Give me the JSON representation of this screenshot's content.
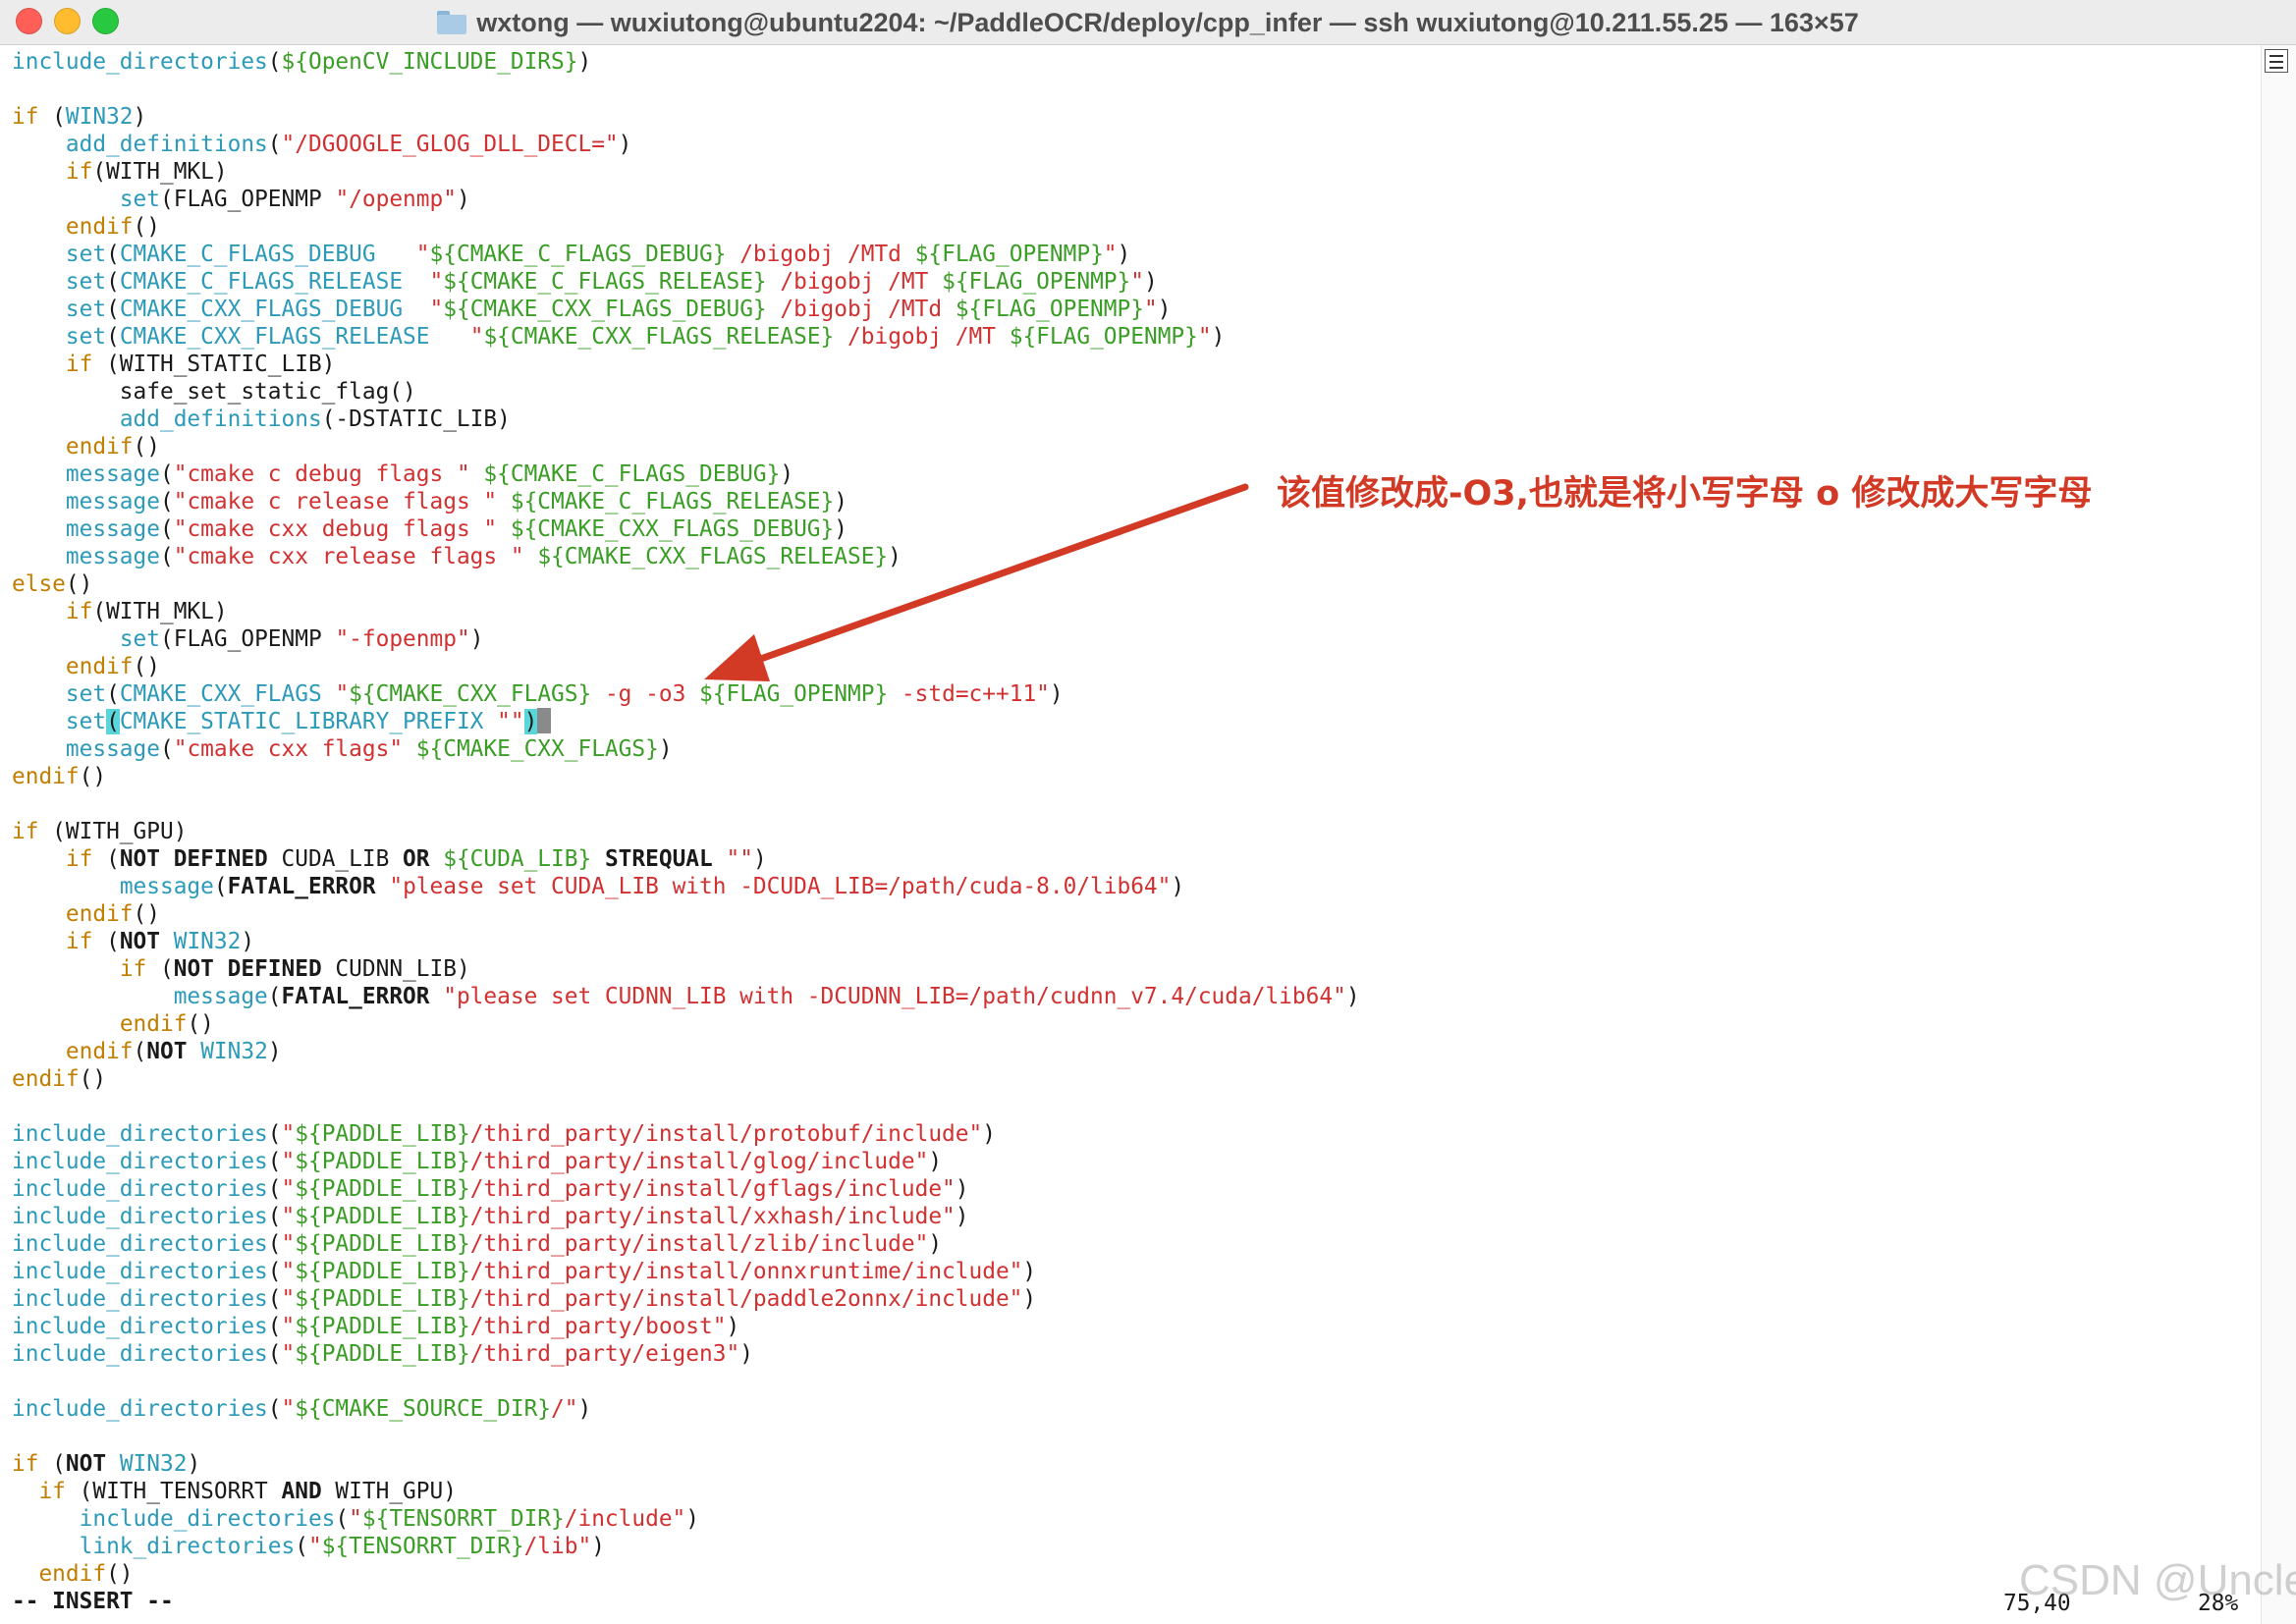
{
  "window": {
    "title": "wxtong — wuxiutong@ubuntu2204: ~/PaddleOCR/deploy/cpp_infer — ssh wuxiutong@10.211.55.25 — 163×57"
  },
  "editor": {
    "lines": [
      [
        [
          "f",
          "include_directories"
        ],
        [
          "p",
          "("
        ],
        [
          "v",
          "${OpenCV_INCLUDE_DIRS}"
        ],
        [
          "p",
          ")"
        ]
      ],
      [],
      [
        [
          "k",
          "if"
        ],
        [
          "p",
          " ("
        ],
        [
          "vr",
          "WIN32"
        ],
        [
          "p",
          ")"
        ]
      ],
      [
        [
          "p",
          "    "
        ],
        [
          "f",
          "add_definitions"
        ],
        [
          "p",
          "("
        ],
        [
          "s",
          "\"/DGOOGLE_GLOG_DLL_DECL=\""
        ],
        [
          "p",
          ")"
        ]
      ],
      [
        [
          "p",
          "    "
        ],
        [
          "k",
          "if"
        ],
        [
          "p",
          "(WITH_MKL)"
        ]
      ],
      [
        [
          "p",
          "        "
        ],
        [
          "f",
          "set"
        ],
        [
          "p",
          "(FLAG_OPENMP "
        ],
        [
          "s",
          "\"/openmp\""
        ],
        [
          "p",
          ")"
        ]
      ],
      [
        [
          "p",
          "    "
        ],
        [
          "k",
          "endif"
        ],
        [
          "p",
          "()"
        ]
      ],
      [
        [
          "p",
          "    "
        ],
        [
          "f",
          "set"
        ],
        [
          "p",
          "("
        ],
        [
          "vr",
          "CMAKE_C_FLAGS_DEBUG"
        ],
        [
          "p",
          "   "
        ],
        [
          "s",
          "\""
        ],
        [
          "v",
          "${CMAKE_C_FLAGS_DEBUG}"
        ],
        [
          "s",
          " /bigobj /MTd "
        ],
        [
          "v",
          "${FLAG_OPENMP}"
        ],
        [
          "s",
          "\""
        ],
        [
          "p",
          ")"
        ]
      ],
      [
        [
          "p",
          "    "
        ],
        [
          "f",
          "set"
        ],
        [
          "p",
          "("
        ],
        [
          "vr",
          "CMAKE_C_FLAGS_RELEASE"
        ],
        [
          "p",
          "  "
        ],
        [
          "s",
          "\""
        ],
        [
          "v",
          "${CMAKE_C_FLAGS_RELEASE}"
        ],
        [
          "s",
          " /bigobj /MT "
        ],
        [
          "v",
          "${FLAG_OPENMP}"
        ],
        [
          "s",
          "\""
        ],
        [
          "p",
          ")"
        ]
      ],
      [
        [
          "p",
          "    "
        ],
        [
          "f",
          "set"
        ],
        [
          "p",
          "("
        ],
        [
          "vr",
          "CMAKE_CXX_FLAGS_DEBUG"
        ],
        [
          "p",
          "  "
        ],
        [
          "s",
          "\""
        ],
        [
          "v",
          "${CMAKE_CXX_FLAGS_DEBUG}"
        ],
        [
          "s",
          " /bigobj /MTd "
        ],
        [
          "v",
          "${FLAG_OPENMP}"
        ],
        [
          "s",
          "\""
        ],
        [
          "p",
          ")"
        ]
      ],
      [
        [
          "p",
          "    "
        ],
        [
          "f",
          "set"
        ],
        [
          "p",
          "("
        ],
        [
          "vr",
          "CMAKE_CXX_FLAGS_RELEASE"
        ],
        [
          "p",
          "   "
        ],
        [
          "s",
          "\""
        ],
        [
          "v",
          "${CMAKE_CXX_FLAGS_RELEASE}"
        ],
        [
          "s",
          " /bigobj /MT "
        ],
        [
          "v",
          "${FLAG_OPENMP}"
        ],
        [
          "s",
          "\""
        ],
        [
          "p",
          ")"
        ]
      ],
      [
        [
          "p",
          "    "
        ],
        [
          "k",
          "if"
        ],
        [
          "p",
          " (WITH_STATIC_LIB)"
        ]
      ],
      [
        [
          "p",
          "        safe_set_static_flag()"
        ]
      ],
      [
        [
          "p",
          "        "
        ],
        [
          "f",
          "add_definitions"
        ],
        [
          "p",
          "(-DSTATIC_LIB)"
        ]
      ],
      [
        [
          "p",
          "    "
        ],
        [
          "k",
          "endif"
        ],
        [
          "p",
          "()"
        ]
      ],
      [
        [
          "p",
          "    "
        ],
        [
          "f",
          "message"
        ],
        [
          "p",
          "("
        ],
        [
          "s",
          "\"cmake c debug flags \""
        ],
        [
          "p",
          " "
        ],
        [
          "v",
          "${CMAKE_C_FLAGS_DEBUG}"
        ],
        [
          "p",
          ")"
        ]
      ],
      [
        [
          "p",
          "    "
        ],
        [
          "f",
          "message"
        ],
        [
          "p",
          "("
        ],
        [
          "s",
          "\"cmake c release flags \""
        ],
        [
          "p",
          " "
        ],
        [
          "v",
          "${CMAKE_C_FLAGS_RELEASE}"
        ],
        [
          "p",
          ")"
        ]
      ],
      [
        [
          "p",
          "    "
        ],
        [
          "f",
          "message"
        ],
        [
          "p",
          "("
        ],
        [
          "s",
          "\"cmake cxx debug flags \""
        ],
        [
          "p",
          " "
        ],
        [
          "v",
          "${CMAKE_CXX_FLAGS_DEBUG}"
        ],
        [
          "p",
          ")"
        ]
      ],
      [
        [
          "p",
          "    "
        ],
        [
          "f",
          "message"
        ],
        [
          "p",
          "("
        ],
        [
          "s",
          "\"cmake cxx release flags \""
        ],
        [
          "p",
          " "
        ],
        [
          "v",
          "${CMAKE_CXX_FLAGS_RELEASE}"
        ],
        [
          "p",
          ")"
        ]
      ],
      [
        [
          "k",
          "else"
        ],
        [
          "p",
          "()"
        ]
      ],
      [
        [
          "p",
          "    "
        ],
        [
          "k",
          "if"
        ],
        [
          "p",
          "(WITH_MKL)"
        ]
      ],
      [
        [
          "p",
          "        "
        ],
        [
          "f",
          "set"
        ],
        [
          "p",
          "(FLAG_OPENMP "
        ],
        [
          "s",
          "\"-fopenmp\""
        ],
        [
          "p",
          ")"
        ]
      ],
      [
        [
          "p",
          "    "
        ],
        [
          "k",
          "endif"
        ],
        [
          "p",
          "()"
        ]
      ],
      [
        [
          "p",
          "    "
        ],
        [
          "f",
          "set"
        ],
        [
          "p",
          "("
        ],
        [
          "vr",
          "CMAKE_CXX_FLAGS"
        ],
        [
          "p",
          " "
        ],
        [
          "s",
          "\""
        ],
        [
          "v",
          "${CMAKE_CXX_FLAGS}"
        ],
        [
          "s",
          " -g -o3 "
        ],
        [
          "v",
          "${FLAG_OPENMP}"
        ],
        [
          "s",
          " -std=c++11\""
        ],
        [
          "p",
          ")"
        ]
      ],
      [
        [
          "p",
          "    "
        ],
        [
          "f",
          "set"
        ],
        [
          "hl",
          "("
        ],
        [
          "vr",
          "CMAKE_STATIC_LIBRARY_PREFIX"
        ],
        [
          "p",
          " "
        ],
        [
          "s",
          "\"\""
        ],
        [
          "hl",
          ")"
        ],
        [
          "cur",
          ""
        ]
      ],
      [
        [
          "p",
          "    "
        ],
        [
          "f",
          "message"
        ],
        [
          "p",
          "("
        ],
        [
          "s",
          "\"cmake cxx flags\""
        ],
        [
          "p",
          " "
        ],
        [
          "v",
          "${CMAKE_CXX_FLAGS}"
        ],
        [
          "p",
          ")"
        ]
      ],
      [
        [
          "k",
          "endif"
        ],
        [
          "p",
          "()"
        ]
      ],
      [],
      [
        [
          "k",
          "if"
        ],
        [
          "p",
          " (WITH_GPU)"
        ]
      ],
      [
        [
          "p",
          "    "
        ],
        [
          "k",
          "if"
        ],
        [
          "p",
          " ("
        ],
        [
          "b",
          "NOT DEFINED"
        ],
        [
          "p",
          " CUDA_LIB "
        ],
        [
          "b",
          "OR"
        ],
        [
          "p",
          " "
        ],
        [
          "v",
          "${CUDA_LIB}"
        ],
        [
          "p",
          " "
        ],
        [
          "b",
          "STREQUAL"
        ],
        [
          "p",
          " "
        ],
        [
          "s",
          "\"\""
        ],
        [
          "p",
          ")"
        ]
      ],
      [
        [
          "p",
          "        "
        ],
        [
          "f",
          "message"
        ],
        [
          "p",
          "("
        ],
        [
          "b",
          "FATAL_ERROR"
        ],
        [
          "p",
          " "
        ],
        [
          "s",
          "\"please set CUDA_LIB with -DCUDA_LIB=/path/cuda-8.0/lib64\""
        ],
        [
          "p",
          ")"
        ]
      ],
      [
        [
          "p",
          "    "
        ],
        [
          "k",
          "endif"
        ],
        [
          "p",
          "()"
        ]
      ],
      [
        [
          "p",
          "    "
        ],
        [
          "k",
          "if"
        ],
        [
          "p",
          " ("
        ],
        [
          "b",
          "NOT"
        ],
        [
          "p",
          " "
        ],
        [
          "vr",
          "WIN32"
        ],
        [
          "p",
          ")"
        ]
      ],
      [
        [
          "p",
          "        "
        ],
        [
          "k",
          "if"
        ],
        [
          "p",
          " ("
        ],
        [
          "b",
          "NOT DEFINED"
        ],
        [
          "p",
          " CUDNN_LIB)"
        ]
      ],
      [
        [
          "p",
          "            "
        ],
        [
          "f",
          "message"
        ],
        [
          "p",
          "("
        ],
        [
          "b",
          "FATAL_ERROR"
        ],
        [
          "p",
          " "
        ],
        [
          "s",
          "\"please set CUDNN_LIB with -DCUDNN_LIB=/path/cudnn_v7.4/cuda/lib64\""
        ],
        [
          "p",
          ")"
        ]
      ],
      [
        [
          "p",
          "        "
        ],
        [
          "k",
          "endif"
        ],
        [
          "p",
          "()"
        ]
      ],
      [
        [
          "p",
          "    "
        ],
        [
          "k",
          "endif"
        ],
        [
          "p",
          "("
        ],
        [
          "b",
          "NOT"
        ],
        [
          "p",
          " "
        ],
        [
          "vr",
          "WIN32"
        ],
        [
          "p",
          ")"
        ]
      ],
      [
        [
          "k",
          "endif"
        ],
        [
          "p",
          "()"
        ]
      ],
      [],
      [
        [
          "f",
          "include_directories"
        ],
        [
          "p",
          "("
        ],
        [
          "s",
          "\""
        ],
        [
          "v",
          "${PADDLE_LIB}"
        ],
        [
          "s",
          "/third_party/install/protobuf/include\""
        ],
        [
          "p",
          ")"
        ]
      ],
      [
        [
          "f",
          "include_directories"
        ],
        [
          "p",
          "("
        ],
        [
          "s",
          "\""
        ],
        [
          "v",
          "${PADDLE_LIB}"
        ],
        [
          "s",
          "/third_party/install/glog/include\""
        ],
        [
          "p",
          ")"
        ]
      ],
      [
        [
          "f",
          "include_directories"
        ],
        [
          "p",
          "("
        ],
        [
          "s",
          "\""
        ],
        [
          "v",
          "${PADDLE_LIB}"
        ],
        [
          "s",
          "/third_party/install/gflags/include\""
        ],
        [
          "p",
          ")"
        ]
      ],
      [
        [
          "f",
          "include_directories"
        ],
        [
          "p",
          "("
        ],
        [
          "s",
          "\""
        ],
        [
          "v",
          "${PADDLE_LIB}"
        ],
        [
          "s",
          "/third_party/install/xxhash/include\""
        ],
        [
          "p",
          ")"
        ]
      ],
      [
        [
          "f",
          "include_directories"
        ],
        [
          "p",
          "("
        ],
        [
          "s",
          "\""
        ],
        [
          "v",
          "${PADDLE_LIB}"
        ],
        [
          "s",
          "/third_party/install/zlib/include\""
        ],
        [
          "p",
          ")"
        ]
      ],
      [
        [
          "f",
          "include_directories"
        ],
        [
          "p",
          "("
        ],
        [
          "s",
          "\""
        ],
        [
          "v",
          "${PADDLE_LIB}"
        ],
        [
          "s",
          "/third_party/install/onnxruntime/include\""
        ],
        [
          "p",
          ")"
        ]
      ],
      [
        [
          "f",
          "include_directories"
        ],
        [
          "p",
          "("
        ],
        [
          "s",
          "\""
        ],
        [
          "v",
          "${PADDLE_LIB}"
        ],
        [
          "s",
          "/third_party/install/paddle2onnx/include\""
        ],
        [
          "p",
          ")"
        ]
      ],
      [
        [
          "f",
          "include_directories"
        ],
        [
          "p",
          "("
        ],
        [
          "s",
          "\""
        ],
        [
          "v",
          "${PADDLE_LIB}"
        ],
        [
          "s",
          "/third_party/boost\""
        ],
        [
          "p",
          ")"
        ]
      ],
      [
        [
          "f",
          "include_directories"
        ],
        [
          "p",
          "("
        ],
        [
          "s",
          "\""
        ],
        [
          "v",
          "${PADDLE_LIB}"
        ],
        [
          "s",
          "/third_party/eigen3\""
        ],
        [
          "p",
          ")"
        ]
      ],
      [],
      [
        [
          "f",
          "include_directories"
        ],
        [
          "p",
          "("
        ],
        [
          "s",
          "\""
        ],
        [
          "v",
          "${CMAKE_SOURCE_DIR}"
        ],
        [
          "s",
          "/\""
        ],
        [
          "p",
          ")"
        ]
      ],
      [],
      [
        [
          "k",
          "if"
        ],
        [
          "p",
          " ("
        ],
        [
          "b",
          "NOT"
        ],
        [
          "p",
          " "
        ],
        [
          "vr",
          "WIN32"
        ],
        [
          "p",
          ")"
        ]
      ],
      [
        [
          "p",
          "  "
        ],
        [
          "k",
          "if"
        ],
        [
          "p",
          " (WITH_TENSORRT "
        ],
        [
          "b",
          "AND"
        ],
        [
          "p",
          " WITH_GPU)"
        ]
      ],
      [
        [
          "p",
          "     "
        ],
        [
          "f",
          "include_directories"
        ],
        [
          "p",
          "("
        ],
        [
          "s",
          "\""
        ],
        [
          "v",
          "${TENSORRT_DIR}"
        ],
        [
          "s",
          "/include\""
        ],
        [
          "p",
          ")"
        ]
      ],
      [
        [
          "p",
          "     "
        ],
        [
          "f",
          "link_directories"
        ],
        [
          "p",
          "("
        ],
        [
          "s",
          "\""
        ],
        [
          "v",
          "${TENSORRT_DIR}"
        ],
        [
          "s",
          "/lib\""
        ],
        [
          "p",
          ")"
        ]
      ],
      [
        [
          "p",
          "  "
        ],
        [
          "k",
          "endif"
        ],
        [
          "p",
          "()"
        ]
      ]
    ]
  },
  "status": {
    "mode": "-- INSERT --",
    "position": "75,40",
    "percent": "28%"
  },
  "annotation": {
    "text": "该值修改成-O3,也就是将小写字母 o 修改成大写字母",
    "color": "#d23a26"
  },
  "watermark": {
    "text": "CSDN @Uncle"
  },
  "colors": {
    "keyword": "#c27e00",
    "function": "#2c9ab8",
    "variable": "#3a9e26",
    "string": "#d13131",
    "match_highlight": "#5ad6da"
  }
}
